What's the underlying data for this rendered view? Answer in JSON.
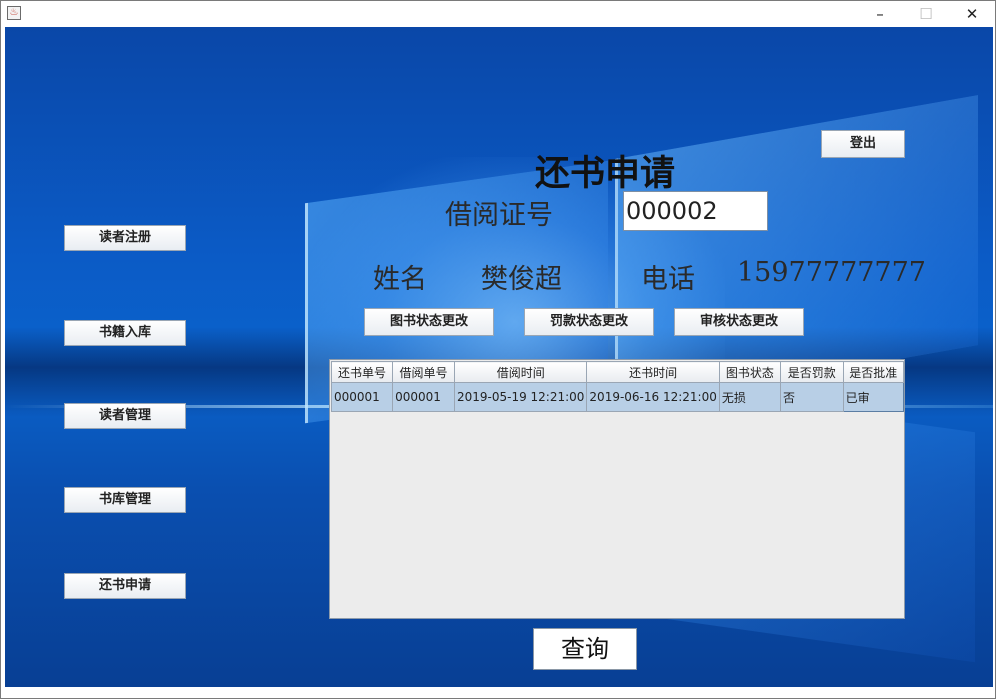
{
  "window": {
    "app_icon": "java-cup-icon",
    "controls": {
      "minimize": "–",
      "maximize": "☐",
      "close": "✕"
    }
  },
  "sidebar": {
    "items": [
      {
        "label": "读者注册"
      },
      {
        "label": "书籍入库"
      },
      {
        "label": "读者管理"
      },
      {
        "label": "书库管理"
      },
      {
        "label": "还书申请"
      }
    ]
  },
  "header": {
    "logout_label": "登出",
    "title": "还书申请"
  },
  "form": {
    "card_label": "借阅证号",
    "card_value": "000002",
    "name_label": "姓名",
    "name_value": "樊俊超",
    "phone_label": "电话",
    "phone_value": "15977777777"
  },
  "actions": {
    "book_status": "图书状态更改",
    "fine_status": "罚款状态更改",
    "review_status": "审核状态更改"
  },
  "table": {
    "columns": [
      "还书单号",
      "借阅单号",
      "借阅时间",
      "还书时间",
      "图书状态",
      "是否罚款",
      "是否批准"
    ],
    "rows": [
      [
        "000001",
        "000001",
        "2019-05-19 12:21:00",
        "2019-06-16 12:21:00",
        "无损",
        "否",
        "已审"
      ]
    ]
  },
  "query_label": "查询",
  "colors": {
    "desktop_blue": "#0b5bc6",
    "row_selected": "#b8cfe6"
  }
}
